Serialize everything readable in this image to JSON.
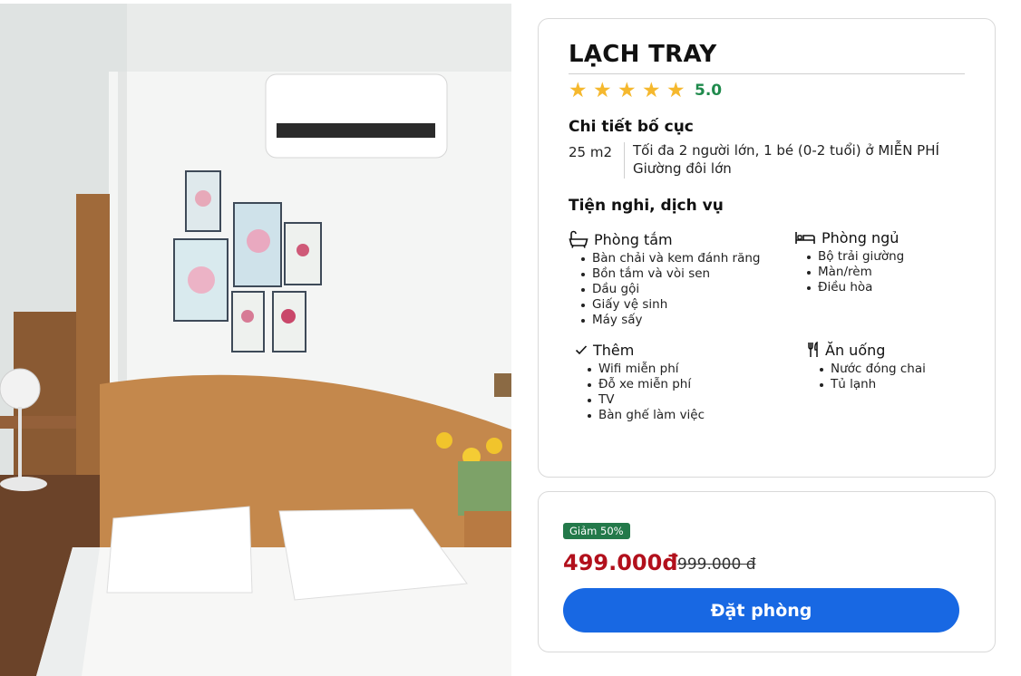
{
  "room": {
    "name": "LẠCH TRAY",
    "rating": {
      "stars": 5,
      "value": "5.0",
      "star_glyph": "★"
    },
    "photo": {
      "description_icon": "room-photo",
      "alt": "Bedroom"
    }
  },
  "layout": {
    "title": "Chi tiết bố cục",
    "area": "25 m2",
    "lines": [
      "Tối đa 2 người lớn, 1 bé (0-2 tuổi) ở MIỄN PHÍ",
      "Giường đôi lớn"
    ]
  },
  "amenities": {
    "title": "Tiện nghi, dịch vụ",
    "groups": [
      {
        "icon": "bathtub-icon",
        "title": "Phòng tắm",
        "items": [
          "Bàn chải và kem đánh răng",
          "Bồn tắm và vòi sen",
          "Dầu gội",
          "Giấy vệ sinh",
          "Máy sấy"
        ]
      },
      {
        "icon": "bed-icon",
        "title": "Phòng ngủ",
        "items": [
          "Bộ trải giường",
          "Màn/rèm",
          "Điều hòa"
        ]
      },
      {
        "icon": "check-icon",
        "title": "Thêm",
        "items": [
          "Wifi miễn phí",
          "Đỗ xe miễn phí",
          "TV",
          "Bàn ghế làm việc"
        ]
      },
      {
        "icon": "fork-knife-icon",
        "title": "Ăn uống",
        "items": [
          "Nước đóng chai",
          "Tủ lạnh"
        ]
      }
    ]
  },
  "pricing": {
    "discount_badge": "Giảm 50%",
    "price": "499.000đ",
    "original_price": "999.000 đ",
    "book_label": "Đặt phòng"
  },
  "colors": {
    "star": "#f5b82e",
    "rating": "#1f8a4c",
    "discount_badge": "#23794a",
    "price": "#b2101c",
    "button": "#1868e3"
  }
}
